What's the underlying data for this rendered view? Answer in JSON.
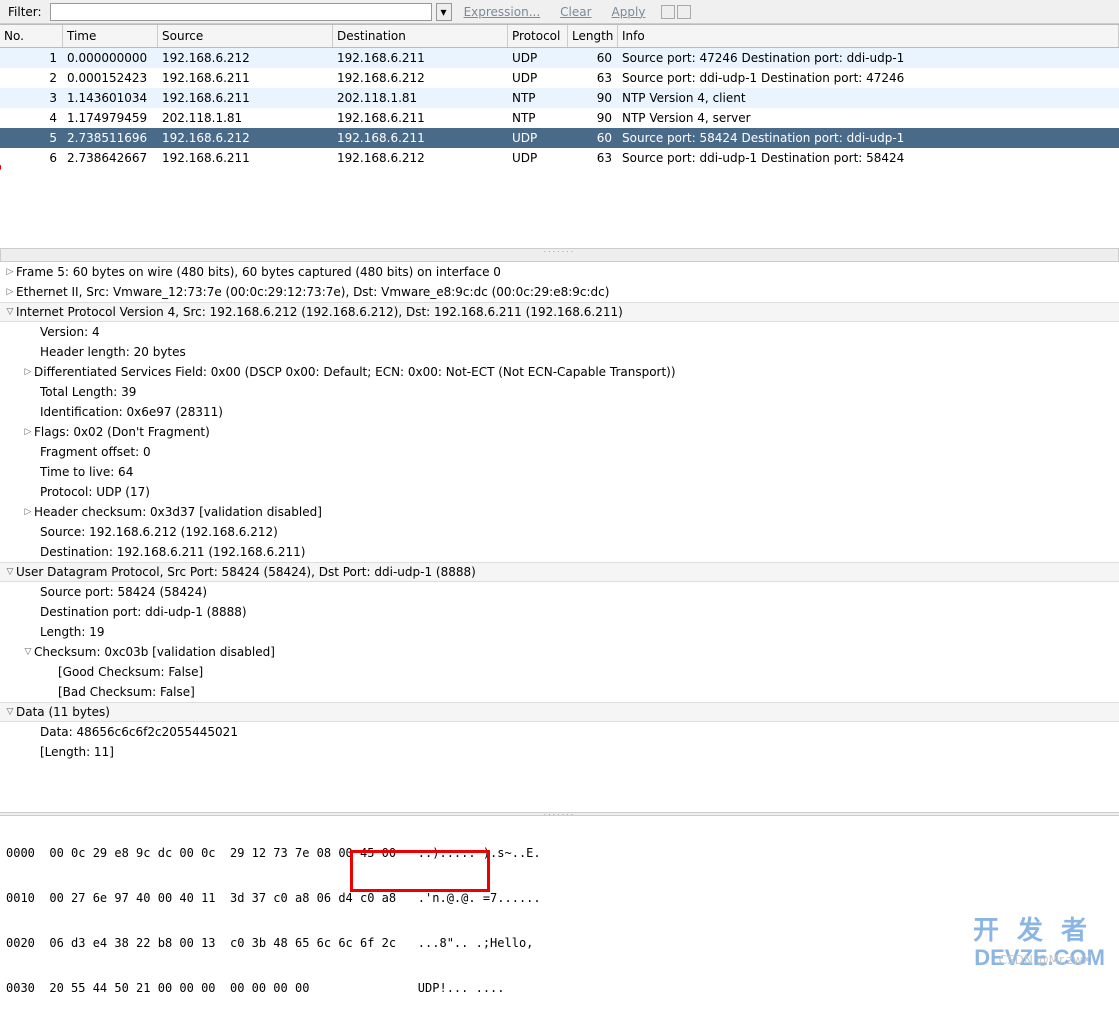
{
  "toolbar": {
    "filter_label": "Filter:",
    "filter_value": "",
    "expression": "Expression...",
    "clear": "Clear",
    "apply": "Apply"
  },
  "columns": {
    "no": "No.",
    "time": "Time",
    "source": "Source",
    "destination": "Destination",
    "protocol": "Protocol",
    "length": "Length",
    "info": "Info"
  },
  "packets": [
    {
      "no": "1",
      "time": "0.000000000",
      "src": "192.168.6.212",
      "dst": "192.168.6.211",
      "proto": "UDP",
      "len": "60",
      "info": "Source port: 47246  Destination port: ddi-udp-1",
      "cls": "row-even"
    },
    {
      "no": "2",
      "time": "0.000152423",
      "src": "192.168.6.211",
      "dst": "192.168.6.212",
      "proto": "UDP",
      "len": "63",
      "info": "Source port: ddi-udp-1  Destination port: 47246",
      "cls": "row-odd"
    },
    {
      "no": "3",
      "time": "1.143601034",
      "src": "192.168.6.211",
      "dst": "202.118.1.81",
      "proto": "NTP",
      "len": "90",
      "info": "NTP Version 4, client",
      "cls": "row-even"
    },
    {
      "no": "4",
      "time": "1.174979459",
      "src": "202.118.1.81",
      "dst": "192.168.6.211",
      "proto": "NTP",
      "len": "90",
      "info": "NTP Version 4, server",
      "cls": "row-odd"
    },
    {
      "no": "5",
      "time": "2.738511696",
      "src": "192.168.6.212",
      "dst": "192.168.6.211",
      "proto": "UDP",
      "len": "60",
      "info": "Source port: 58424  Destination port: ddi-udp-1",
      "cls": "row-selected"
    },
    {
      "no": "6",
      "time": "2.738642667",
      "src": "192.168.6.211",
      "dst": "192.168.6.212",
      "proto": "UDP",
      "len": "63",
      "info": "Source port: ddi-udp-1  Destination port: 58424",
      "cls": "row-odd"
    }
  ],
  "details": {
    "frame": "Frame 5: 60 bytes on wire (480 bits), 60 bytes captured (480 bits) on interface 0",
    "eth": "Ethernet II, Src: Vmware_12:73:7e (00:0c:29:12:73:7e), Dst: Vmware_e8:9c:dc (00:0c:29:e8:9c:dc)",
    "ip": "Internet Protocol Version 4, Src: 192.168.6.212 (192.168.6.212), Dst: 192.168.6.211 (192.168.6.211)",
    "ip_version": "Version: 4",
    "ip_hlen": "Header length: 20 bytes",
    "ip_dsf": "Differentiated Services Field: 0x00 (DSCP 0x00: Default; ECN: 0x00: Not-ECT (Not ECN-Capable Transport))",
    "ip_tlen": "Total Length: 39",
    "ip_id": "Identification: 0x6e97 (28311)",
    "ip_flags": "Flags: 0x02 (Don't Fragment)",
    "ip_frag": "Fragment offset: 0",
    "ip_ttl": "Time to live: 64",
    "ip_proto": "Protocol: UDP (17)",
    "ip_chk": "Header checksum: 0x3d37 [validation disabled]",
    "ip_src": "Source: 192.168.6.212 (192.168.6.212)",
    "ip_dst": "Destination: 192.168.6.211 (192.168.6.211)",
    "udp": "User Datagram Protocol, Src Port: 58424 (58424), Dst Port: ddi-udp-1 (8888)",
    "udp_sport": "Source port: 58424 (58424)",
    "udp_dport": "Destination port: ddi-udp-1 (8888)",
    "udp_len": "Length: 19",
    "udp_chk": "Checksum: 0xc03b [validation disabled]",
    "udp_good": "[Good Checksum: False]",
    "udp_bad": "[Bad Checksum: False]",
    "data": "Data (11 bytes)",
    "data_hex": "Data: 48656c6c6f2c2055445021",
    "data_len": "[Length: 11]"
  },
  "bytes": {
    "r0": "0000  00 0c 29 e8 9c dc 00 0c  29 12 73 7e 08 00 45 00   ..)..... ).s~..E.",
    "r1": "0010  00 27 6e 97 40 00 40 11  3d 37 c0 a8 06 d4 c0 a8   .'n.@.@. =7......",
    "r2": "0020  06 d3 e4 38 22 b8 00 13  c0 3b 48 65 6c 6c 6f 2c   ...8\".. .;Hello,",
    "r3": "0030  20 55 44 50 21 00 00 00  00 00 00 00               UDP!... ...."
  },
  "watermark": {
    "cn": "开发者",
    "en": "DEVZE.COM",
    "csdn": "CSDN @Mr.zwX"
  }
}
